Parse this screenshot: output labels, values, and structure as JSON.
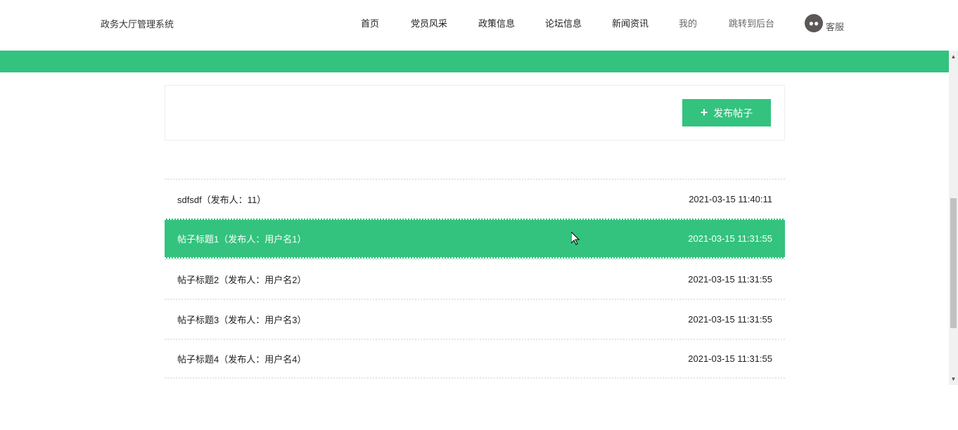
{
  "brand": "政务大厅管理系统",
  "nav": [
    {
      "label": "首页"
    },
    {
      "label": "党员风采"
    },
    {
      "label": "政策信息"
    },
    {
      "label": "论坛信息"
    },
    {
      "label": "新闻资讯"
    },
    {
      "label": "我的"
    },
    {
      "label": "跳转到后台"
    }
  ],
  "service": {
    "label": "客服",
    "icon": "wechat-icon"
  },
  "publish_label": "发布帖子",
  "posts": [
    {
      "title": "sdfsdf（发布人：11）",
      "time": "2021-03-15 11:40:11"
    },
    {
      "title": "帖子标题1（发布人：用户名1）",
      "time": "2021-03-15 11:31:55"
    },
    {
      "title": "帖子标题2（发布人：用户名2）",
      "time": "2021-03-15 11:31:55"
    },
    {
      "title": "帖子标题3（发布人：用户名3）",
      "time": "2021-03-15 11:31:55"
    },
    {
      "title": "帖子标题4（发布人：用户名4）",
      "time": "2021-03-15 11:31:55"
    }
  ],
  "accent": "#33c37e"
}
